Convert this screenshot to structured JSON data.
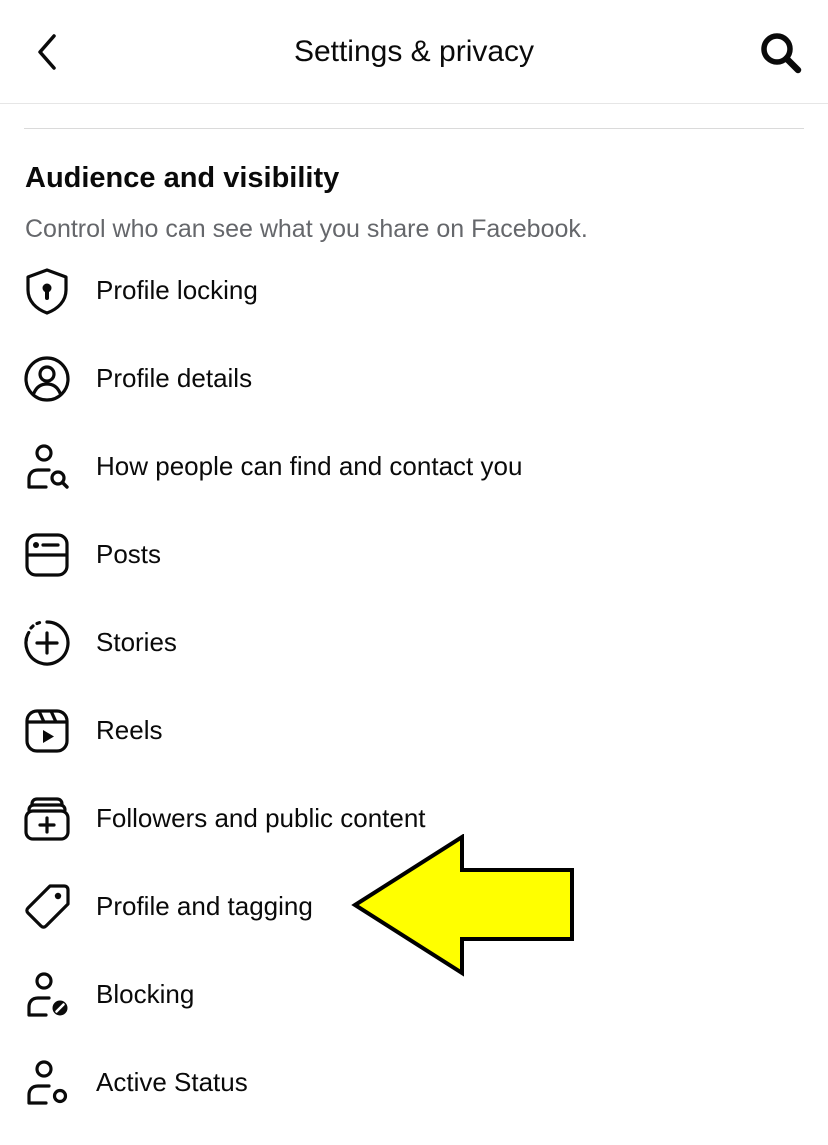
{
  "header": {
    "title": "Settings & privacy",
    "back_icon": "chevron-left-icon",
    "search_icon": "search-icon"
  },
  "section": {
    "title": "Audience and visibility",
    "description": "Control who can see what you share on Facebook."
  },
  "menu": {
    "items": [
      {
        "label": "Profile locking",
        "icon": "shield-lock-icon"
      },
      {
        "label": "Profile details",
        "icon": "profile-circle-icon"
      },
      {
        "label": "How people can find and contact you",
        "icon": "person-search-icon"
      },
      {
        "label": "Posts",
        "icon": "posts-icon"
      },
      {
        "label": "Stories",
        "icon": "stories-plus-icon"
      },
      {
        "label": "Reels",
        "icon": "reels-icon"
      },
      {
        "label": "Followers and public content",
        "icon": "followers-stack-icon"
      },
      {
        "label": "Profile and tagging",
        "icon": "tag-icon"
      },
      {
        "label": "Blocking",
        "icon": "person-block-icon"
      },
      {
        "label": "Active Status",
        "icon": "person-status-icon"
      }
    ]
  },
  "annotation": {
    "arrow_icon": "yellow-arrow-icon",
    "arrow_color": "#ffff00",
    "points_to": "Profile and tagging"
  },
  "colors": {
    "text": "#0a0a0a",
    "secondary_text": "#65676b",
    "divider": "#dadada"
  }
}
